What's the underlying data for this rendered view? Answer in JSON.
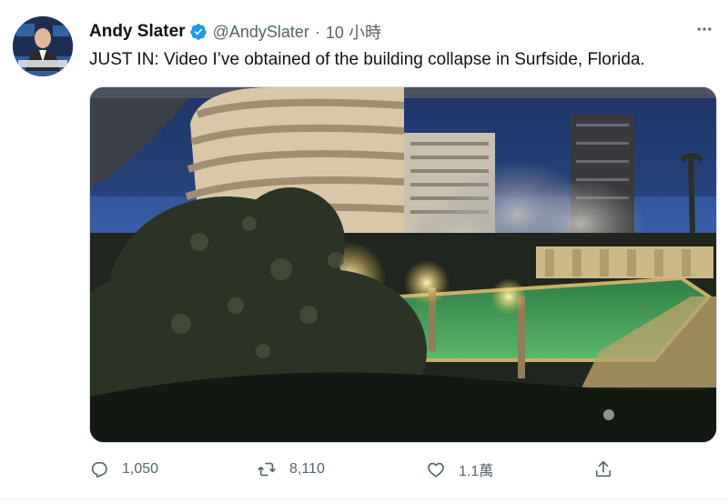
{
  "author": {
    "name": "Andy Slater",
    "handle": "@AndySlater",
    "separator": "·",
    "time": "10 小時",
    "verified": true
  },
  "tweet": {
    "text": "JUST IN: Video I’ve obtained of the building collapse in Surfside, Florida."
  },
  "actions": {
    "reply_count": "1,050",
    "retweet_count": "8,110",
    "like_count": "1.1萬"
  },
  "colors": {
    "verified_blue": "#1d9bf0",
    "text_primary": "#0f1419",
    "text_secondary": "#536471",
    "pool_green": "#3f9a52"
  },
  "icons": {
    "more": "more-horizontal-icon",
    "reply": "reply-icon",
    "retweet": "retweet-icon",
    "like": "heart-icon",
    "share": "share-icon",
    "verified": "verified-badge-icon"
  }
}
